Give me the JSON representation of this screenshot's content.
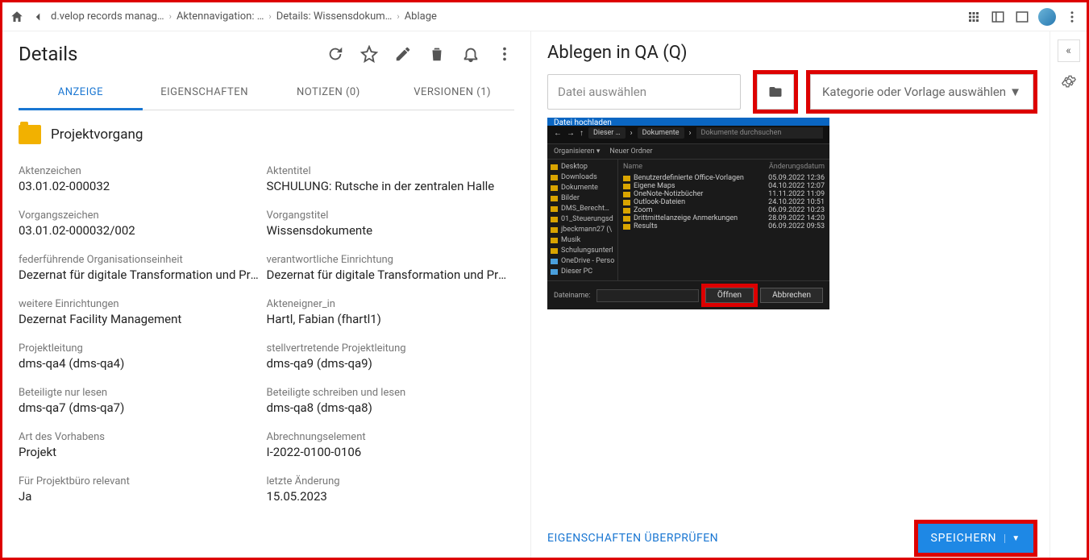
{
  "breadcrumb": {
    "items": [
      "d.velop records manag…",
      "Aktennavigation: …",
      "Details: Wissensdokum…",
      "Ablage"
    ]
  },
  "details": {
    "title": "Details",
    "tabs": [
      "ANZEIGE",
      "EIGENSCHAFTEN",
      "NOTIZEN (0)",
      "VERSIONEN (1)"
    ],
    "doc_type": "Projektvorgang",
    "fields": [
      {
        "lbl": "Aktenzeichen",
        "val": "03.01.02-000032"
      },
      {
        "lbl": "Aktentitel",
        "val": "SCHULUNG: Rutsche in der zentralen Halle"
      },
      {
        "lbl": "Vorgangszeichen",
        "val": "03.01.02-000032/002"
      },
      {
        "lbl": "Vorgangstitel",
        "val": "Wissensdokumente"
      },
      {
        "lbl": "federführende Organisationseinheit",
        "val": "Dezernat für digitale Transformation und Prozes"
      },
      {
        "lbl": "verantwortliche Einrichtung",
        "val": "Dezernat für digitale Transformation und Prozes"
      },
      {
        "lbl": "weitere Einrichtungen",
        "val": "Dezernat Facility Management"
      },
      {
        "lbl": "Akteneigner_in",
        "val": "Hartl, Fabian (fhartl1)"
      },
      {
        "lbl": "Projektleitung",
        "val": "dms-qa4 (dms-qa4)"
      },
      {
        "lbl": "stellvertretende Projektleitung",
        "val": "dms-qa9 (dms-qa9)"
      },
      {
        "lbl": "Beteiligte nur lesen",
        "val": "dms-qa7 (dms-qa7)"
      },
      {
        "lbl": "Beteiligte schreiben und lesen",
        "val": "dms-qa8 (dms-qa8)"
      },
      {
        "lbl": "Art des Vorhabens",
        "val": "Projekt"
      },
      {
        "lbl": "Abrechnungselement",
        "val": "I-2022-0100-0106"
      },
      {
        "lbl": "Für Projektbüro relevant",
        "val": "Ja"
      },
      {
        "lbl": "letzte Änderung",
        "val": "15.05.2023"
      }
    ]
  },
  "upload": {
    "title": "Ablegen in QA (Q)",
    "file_placeholder": "Datei auswählen",
    "category_placeholder": "Kategorie oder Vorlage auswählen",
    "check_props": "EIGENSCHAFTEN ÜBERPRÜFEN",
    "save": "SPEICHERN"
  },
  "dialog": {
    "title": "Datei hochladen",
    "path_segments": [
      "Dieser …",
      "Dokumente"
    ],
    "search_placeholder": "Dokumente durchsuchen",
    "toolbar": {
      "organize": "Organisieren ▾",
      "newfolder": "Neuer Ordner"
    },
    "list_header": {
      "name": "Name",
      "date": "Änderungsdatum"
    },
    "tree": [
      "Desktop",
      "Downloads",
      "Dokumente",
      "Bilder",
      "DMS_Berecht…",
      "01_Steuerungsd",
      "jbeckmann27 (\\",
      "Musik",
      "Schulungsunterl",
      "OneDrive - Persor",
      "Dieser PC"
    ],
    "rows": [
      {
        "n": "Benutzerdefinierte Office-Vorlagen",
        "d": "05.09.2022 12:36"
      },
      {
        "n": "Eigene Maps",
        "d": "04.10.2022 12:07"
      },
      {
        "n": "OneNote-Notizbücher",
        "d": "11.11.2022 11:09"
      },
      {
        "n": "Outlook-Dateien",
        "d": "24.10.2022 10:51"
      },
      {
        "n": "Zoom",
        "d": "06.09.2022 10:23"
      },
      {
        "n": "Drittmittelanzeige Anmerkungen",
        "d": "28.09.2022 14:20"
      },
      {
        "n": "Results",
        "d": "06.09.2022 09:53"
      }
    ],
    "filename_label": "Dateiname:",
    "open": "Öffnen",
    "cancel": "Abbrechen"
  }
}
